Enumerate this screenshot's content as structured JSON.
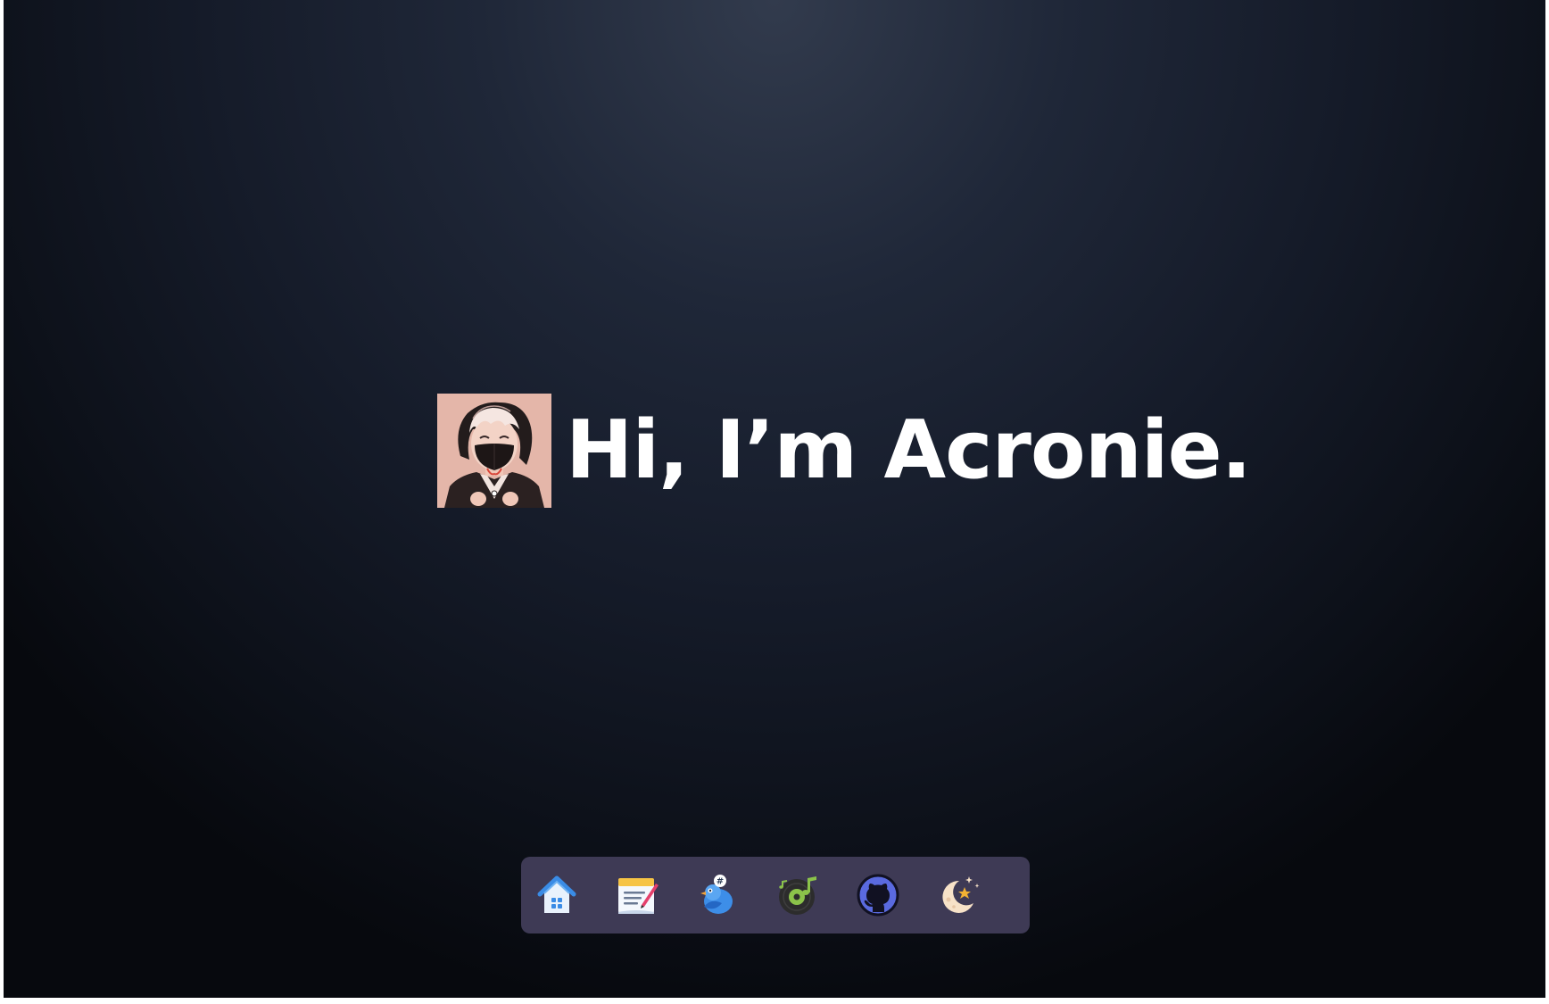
{
  "hero": {
    "greeting": "Hi, I’m Acronie.",
    "avatar": {
      "icon": "masked-character-avatar-icon",
      "background": "#e4b6a9"
    }
  },
  "dock": {
    "background": "#3e3a55",
    "items": [
      {
        "id": "home",
        "icon": "home-icon"
      },
      {
        "id": "notes",
        "icon": "notepad-icon"
      },
      {
        "id": "social",
        "icon": "bird-hashtag-icon"
      },
      {
        "id": "music",
        "icon": "music-disc-icon"
      },
      {
        "id": "github",
        "icon": "github-icon"
      },
      {
        "id": "theme",
        "icon": "moon-stars-icon"
      }
    ]
  },
  "colors": {
    "background_top": "#323b4d",
    "background_bottom": "#07090e",
    "text": "#ffffff"
  }
}
